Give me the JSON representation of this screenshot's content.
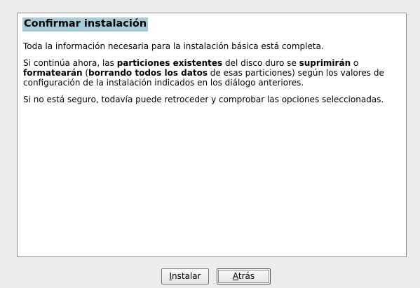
{
  "dialog": {
    "title": "Confirmar instalación",
    "para1": "Toda la información necesaria para la instalación básica está completa.",
    "para2": {
      "t1": "Si continúa ahora, las ",
      "b1": "particiones existentes",
      "t2": " del disco duro se ",
      "b2": "suprimirán",
      "t3": " o ",
      "b3": "formatearán",
      "t4": " (",
      "b4": "borrando todos los datos",
      "t5": " de esas particiones) según los valores de configuración de la instalación indicados en los diálogo anteriores."
    },
    "para3": "Si no está seguro, todavía puede retroceder y comprobar las opciones seleccionadas."
  },
  "buttons": {
    "install": {
      "mnemonic": "I",
      "rest": "nstalar"
    },
    "back": {
      "mnemonic": "A",
      "rest": "trás"
    }
  }
}
